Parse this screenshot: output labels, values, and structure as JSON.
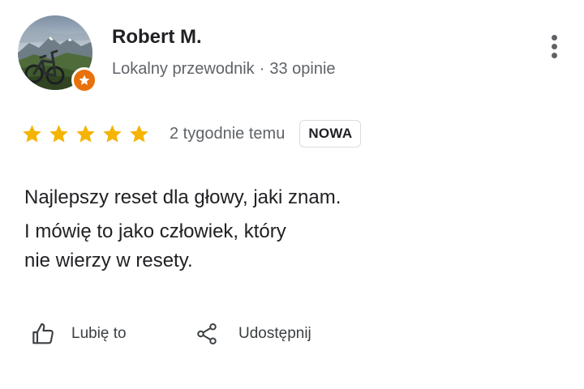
{
  "author": {
    "name": "Robert M.",
    "role": "Lokalny przewodnik",
    "separator": "·",
    "reviews_count": "33 opinie",
    "avatar_icon": "mountain-bike-photo",
    "badge_icon": "local-guide-star-icon",
    "badge_color": "#e8710a"
  },
  "menu": {
    "icon": "more-vertical-icon"
  },
  "rating": {
    "stars": 5,
    "max_stars": 5,
    "star_color": "#f4b400",
    "time": "2 tygodnie temu",
    "badge": "NOWA"
  },
  "review": {
    "line1": "Najlepszy reset dla głowy, jaki znam.",
    "line2": "I mówię to jako człowiek, który",
    "line3": "nie wierzy w resety."
  },
  "actions": {
    "like_label": "Lubię to",
    "like_icon": "thumb-up-icon",
    "share_label": "Udostępnij",
    "share_icon": "share-icon"
  }
}
